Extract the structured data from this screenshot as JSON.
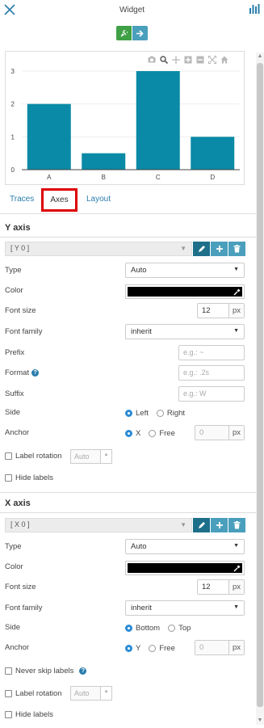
{
  "header": {
    "title": "Widget",
    "close_icon": "close-icon",
    "menu_icon": "chart-menu-icon",
    "mode_buttons": [
      "plug-icon",
      "arrow-right-icon"
    ]
  },
  "chart_data": {
    "type": "bar",
    "categories": [
      "A",
      "B",
      "C",
      "D"
    ],
    "values": [
      2,
      0.5,
      3,
      1
    ],
    "ylim": [
      0,
      3
    ],
    "yticks": [
      "0",
      "1",
      "2",
      "3"
    ],
    "bar_color": "#0a8aa6",
    "modebar_icons": [
      "camera-icon",
      "zoom-icon",
      "pan-icon",
      "zoom-in-icon",
      "zoom-out-icon",
      "autoscale-icon",
      "home-icon"
    ]
  },
  "tabs": [
    {
      "label": "Traces"
    },
    {
      "label": "Axes"
    },
    {
      "label": "Layout"
    }
  ],
  "yaxis": {
    "title": "Y axis",
    "selector": "[ Y 0 ]",
    "type_label": "Type",
    "type_value": "Auto",
    "color_label": "Color",
    "color_value": "#000000",
    "font_size_label": "Font size",
    "font_size_value": "12",
    "font_size_unit": "px",
    "font_family_label": "Font family",
    "font_family_value": "inherit",
    "prefix_label": "Prefix",
    "prefix_placeholder": "e.g.: ~",
    "format_label": "Format",
    "format_placeholder": "e.g.: .2s",
    "suffix_label": "Suffix",
    "suffix_placeholder": "e.g.: W",
    "side_label": "Side",
    "side_options": [
      "Left",
      "Right"
    ],
    "anchor_label": "Anchor",
    "anchor_options": [
      "X",
      "Free"
    ],
    "anchor_free_value": "0",
    "anchor_unit": "px",
    "label_rotation": "Label rotation",
    "rotation_placeholder": "Auto",
    "rotation_unit": "°",
    "hide_labels": "Hide labels"
  },
  "xaxis": {
    "title": "X axis",
    "selector": "[ X 0 ]",
    "type_label": "Type",
    "type_value": "Auto",
    "color_label": "Color",
    "color_value": "#000000",
    "font_size_label": "Font size",
    "font_size_value": "12",
    "font_size_unit": "px",
    "font_family_label": "Font family",
    "font_family_value": "inherit",
    "side_label": "Side",
    "side_options": [
      "Bottom",
      "Top"
    ],
    "anchor_label": "Anchor",
    "anchor_options": [
      "Y",
      "Free"
    ],
    "anchor_free_value": "0",
    "anchor_unit": "px",
    "never_skip": "Never skip labels",
    "label_rotation": "Label rotation",
    "rotation_placeholder": "Auto",
    "rotation_unit": "°",
    "hide_labels": "Hide labels"
  }
}
